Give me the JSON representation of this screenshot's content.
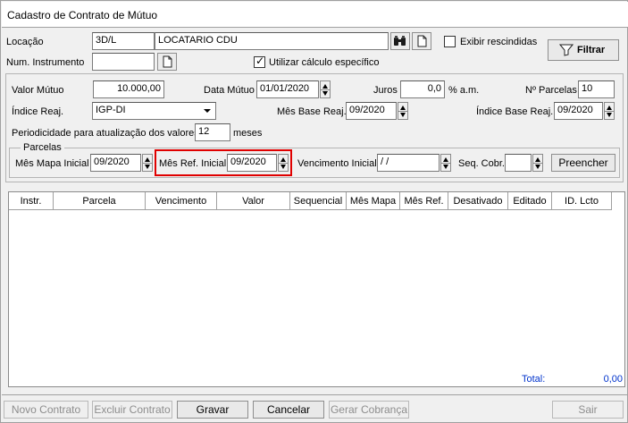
{
  "window": {
    "title": "Cadastro de Contrato de Mútuo"
  },
  "header": {
    "locacao_label": "Locação",
    "locacao_code": "3D/L",
    "locacao_name": "LOCATARIO CDU",
    "exibir_rescindidas_label": "Exibir rescindidas",
    "exibir_rescindidas_checked": false,
    "filtrar_label": "Filtrar",
    "num_instrumento_label": "Num. Instrumento",
    "num_instrumento_value": "",
    "utilizar_calculo_label": "Utilizar cálculo específico",
    "utilizar_calculo_checked": true
  },
  "form": {
    "valor_mutuo_label": "Valor Mútuo",
    "valor_mutuo_value": "10.000,00",
    "data_mutuo_label": "Data Mútuo",
    "data_mutuo_value": "01/01/2020",
    "juros_label": "Juros",
    "juros_value": "0,0",
    "juros_unit": "% a.m.",
    "num_parcelas_label": "Nº Parcelas",
    "num_parcelas_value": "10",
    "indice_reaj_label": "Índice Reaj.",
    "indice_reaj_value": "IGP-DI",
    "mes_base_reaj_label": "Mês Base Reaj.",
    "mes_base_reaj_value": "09/2020",
    "indice_base_reaj_label": "Índice Base Reaj.",
    "indice_base_reaj_value": "09/2020",
    "periodicidade_label": "Periodicidade para atualização dos valores",
    "periodicidade_value": "12",
    "periodicidade_unit": "meses"
  },
  "parcelas": {
    "group_label": "Parcelas",
    "mes_mapa_inicial_label": "Mês Mapa Inicial",
    "mes_mapa_inicial_value": "09/2020",
    "mes_ref_inicial_label": "Mês Ref. Inicial",
    "mes_ref_inicial_value": "09/2020",
    "vencimento_inicial_label": "Vencimento Inicial",
    "vencimento_inicial_value": " / /",
    "seq_cobr_label": "Seq. Cobr.",
    "seq_cobr_value": "",
    "preencher_label": "Preencher",
    "highlight_color": "#e00000"
  },
  "grid": {
    "columns": [
      "Instr.",
      "Parcela",
      "Vencimento",
      "Valor",
      "Sequencial",
      "Mês Mapa",
      "Mês Ref.",
      "Desativado",
      "Editado",
      "ID. Lcto"
    ],
    "rows": [],
    "total_label": "Total:",
    "total_value": "0,00",
    "total_color": "#0033cc"
  },
  "footer": {
    "novo_contrato_label": "Novo Contrato",
    "excluir_contrato_label": "Excluir Contrato",
    "gravar_label": "Gravar",
    "cancelar_label": "Cancelar",
    "gerar_cobranca_label": "Gerar Cobrança",
    "sair_label": "Sair"
  }
}
